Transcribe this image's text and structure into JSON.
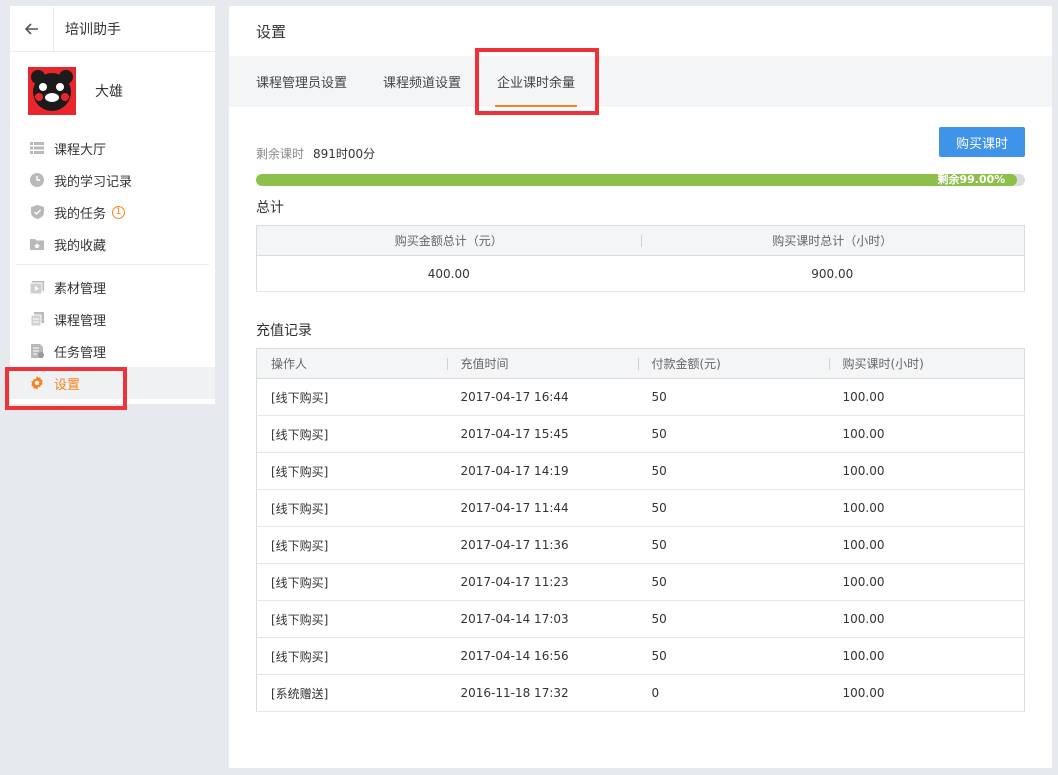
{
  "sidebar": {
    "title": "培训助手",
    "profile_name": "大雄",
    "group1": [
      {
        "label": "课程大厅",
        "icon": "list-icon"
      },
      {
        "label": "我的学习记录",
        "icon": "clock-icon"
      },
      {
        "label": "我的任务",
        "icon": "shield-check-icon",
        "badge": "1"
      },
      {
        "label": "我的收藏",
        "icon": "folder-star-icon"
      }
    ],
    "group2": [
      {
        "label": "素材管理",
        "icon": "media-icon"
      },
      {
        "label": "课程管理",
        "icon": "copy-icon"
      },
      {
        "label": "任务管理",
        "icon": "task-doc-icon"
      },
      {
        "label": "设置",
        "icon": "gear-icon",
        "active": true
      }
    ]
  },
  "main": {
    "title": "设置",
    "tabs": [
      {
        "label": "课程管理员设置"
      },
      {
        "label": "课程频道设置"
      },
      {
        "label": "企业课时余量",
        "active": true
      }
    ],
    "remaining": {
      "label": "剩余课时",
      "value": "891时00分",
      "progress_fraction": 0.99,
      "progress_text": "剩余99.00%"
    },
    "buy_button": "购买课时",
    "total": {
      "title": "总计",
      "headers": [
        "购买金额总计（元）",
        "购买课时总计（小时）"
      ],
      "values": [
        "400.00",
        "900.00"
      ]
    },
    "records": {
      "title": "充值记录",
      "headers": [
        "操作人",
        "充值时间",
        "付款金额(元)",
        "购买课时(小时)"
      ],
      "rows": [
        [
          "[线下购买]",
          "2017-04-17 16:44",
          "50",
          "100.00"
        ],
        [
          "[线下购买]",
          "2017-04-17 15:45",
          "50",
          "100.00"
        ],
        [
          "[线下购买]",
          "2017-04-17 14:19",
          "50",
          "100.00"
        ],
        [
          "[线下购买]",
          "2017-04-17 11:44",
          "50",
          "100.00"
        ],
        [
          "[线下购买]",
          "2017-04-17 11:36",
          "50",
          "100.00"
        ],
        [
          "[线下购买]",
          "2017-04-17 11:23",
          "50",
          "100.00"
        ],
        [
          "[线下购买]",
          "2017-04-14 17:03",
          "50",
          "100.00"
        ],
        [
          "[线下购买]",
          "2017-04-14 16:56",
          "50",
          "100.00"
        ],
        [
          "[系统赠送]",
          "2016-11-18 17:32",
          "0",
          "100.00"
        ]
      ]
    }
  },
  "colors": {
    "accent": "#f5821f",
    "primary_button": "#3f93e8",
    "progress": "#8cc04a",
    "highlight": "#ee3338"
  }
}
